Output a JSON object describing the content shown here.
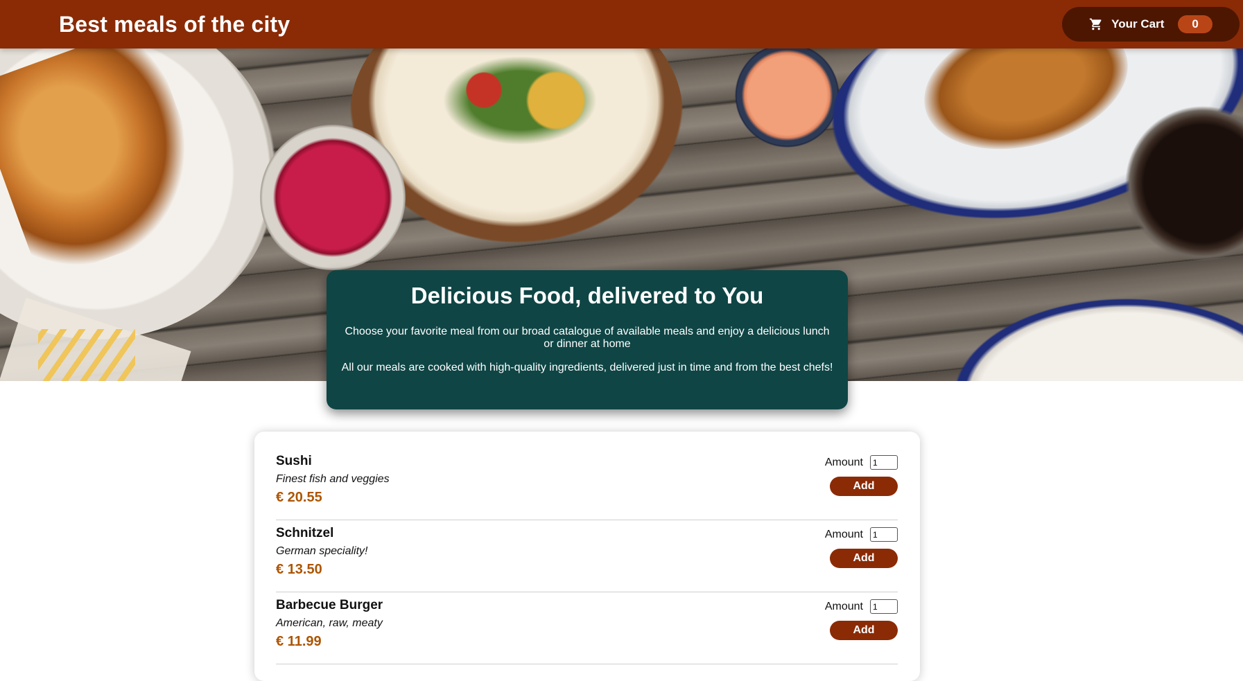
{
  "header": {
    "title": "Best meals of the city",
    "cart": {
      "label": "Your Cart",
      "count": "0",
      "icon": "cart-icon"
    }
  },
  "summary": {
    "heading": "Delicious Food, delivered to You",
    "paragraph1": "Choose your favorite meal from our broad catalogue of available meals and enjoy a delicious lunch or dinner at home",
    "paragraph2": "All our meals are cooked with high-quality ingredients, delivered just in time and from the best chefs!"
  },
  "meals": [
    {
      "name": "Sushi",
      "description": "Finest fish and veggies",
      "price": "€ 20.55",
      "amount_label": "Amount",
      "amount": "1",
      "add_label": "Add"
    },
    {
      "name": "Schnitzel",
      "description": "German speciality!",
      "price": "€ 13.50",
      "amount_label": "Amount",
      "amount": "1",
      "add_label": "Add"
    },
    {
      "name": "Barbecue Burger",
      "description": "American, raw, meaty",
      "price": "€ 11.99",
      "amount_label": "Amount",
      "amount": "1",
      "add_label": "Add"
    }
  ],
  "colors": {
    "header": "#8a2b06",
    "cart_button": "#4d1601",
    "cart_badge": "#b94517",
    "summary_bg": "#0f4545",
    "price": "#ad5502"
  }
}
